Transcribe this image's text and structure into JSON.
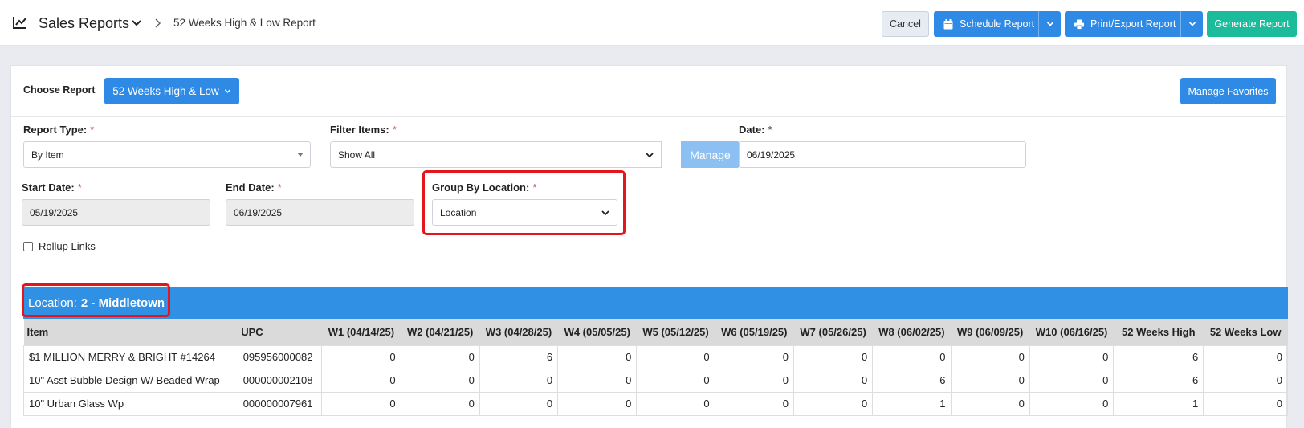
{
  "header": {
    "app_title": "Sales Reports",
    "breadcrumb": "52 Weeks High & Low Report",
    "cancel_label": "Cancel",
    "schedule_label": "Schedule Report",
    "print_label": "Print/Export Report",
    "generate_label": "Generate Report"
  },
  "card": {
    "choose_label": "Choose Report",
    "choose_value": "52 Weeks High & Low",
    "favorites_label": "Manage Favorites"
  },
  "form": {
    "report_type": {
      "label": "Report Type:",
      "value": "By Item"
    },
    "filter_items": {
      "label": "Filter Items:",
      "value": "Show All",
      "manage_label": "Manage"
    },
    "date": {
      "label": "Date:",
      "value": "06/19/2025"
    },
    "start_date": {
      "label": "Start Date:",
      "value": "05/19/2025"
    },
    "end_date": {
      "label": "End Date:",
      "value": "06/19/2025"
    },
    "group_by": {
      "label": "Group By Location:",
      "value": "Location"
    },
    "rollup_label": "Rollup Links",
    "required_mark": "*"
  },
  "location": {
    "prefix": "Location:",
    "name": "2 - Middletown"
  },
  "table": {
    "columns": [
      "Item",
      "UPC",
      "W1 (04/14/25)",
      "W2 (04/21/25)",
      "W3 (04/28/25)",
      "W4 (05/05/25)",
      "W5 (05/12/25)",
      "W6 (05/19/25)",
      "W7 (05/26/25)",
      "W8 (06/02/25)",
      "W9 (06/09/25)",
      "W10 (06/16/25)",
      "52 Weeks High",
      "52 Weeks Low"
    ],
    "rows": [
      [
        "$1 MILLION MERRY & BRIGHT #14264",
        "095956000082",
        "0",
        "0",
        "6",
        "0",
        "0",
        "0",
        "0",
        "0",
        "0",
        "0",
        "6",
        "0"
      ],
      [
        "10\" Asst Bubble Design W/ Beaded Wrap",
        "000000002108",
        "0",
        "0",
        "0",
        "0",
        "0",
        "0",
        "0",
        "6",
        "0",
        "0",
        "6",
        "0"
      ],
      [
        "10\" Urban Glass Wp",
        "000000007961",
        "0",
        "0",
        "0",
        "0",
        "0",
        "0",
        "0",
        "1",
        "0",
        "0",
        "1",
        "0"
      ]
    ]
  },
  "colors": {
    "primary": "#2f8ae6",
    "success": "#1bbc9b",
    "location_bar": "#3090e3",
    "highlight": "#e3161d"
  }
}
